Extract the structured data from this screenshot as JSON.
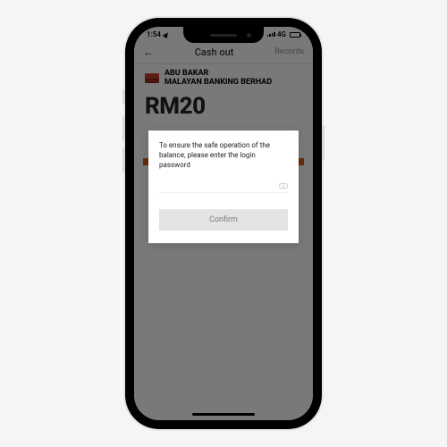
{
  "status": {
    "time": "1:54",
    "network": "4G"
  },
  "header": {
    "title": "Cash out",
    "records": "Records"
  },
  "account": {
    "name": "ABU BAKAR",
    "bank": "MALAYAN BANKING BERHAD"
  },
  "amount": "RM20",
  "modal": {
    "message": "To ensure the safe operation of the balance, please enter the login password",
    "confirm_label": "Confirm"
  }
}
